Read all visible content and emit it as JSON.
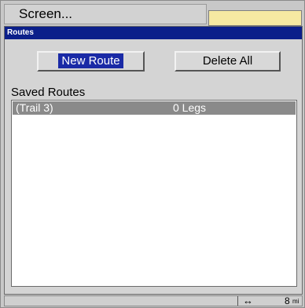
{
  "background": {
    "screen_menu_label": "Screen..."
  },
  "dialog": {
    "title": "Routes",
    "new_route_label": "New Route",
    "delete_all_label": "Delete All",
    "saved_routes_label": "Saved Routes",
    "routes": [
      {
        "name": "(Trail 3)",
        "legs": "0 Legs"
      }
    ]
  },
  "status_bar": {
    "icon": "horizontal-arrow-icon",
    "scale_value": "8",
    "scale_unit": "mi"
  },
  "colors": {
    "title_bar": "#0b1f8a",
    "selected_row": "#8a8a8a",
    "focus_highlight": "#1a2aa6",
    "field_yellow": "#f6e9a2"
  }
}
